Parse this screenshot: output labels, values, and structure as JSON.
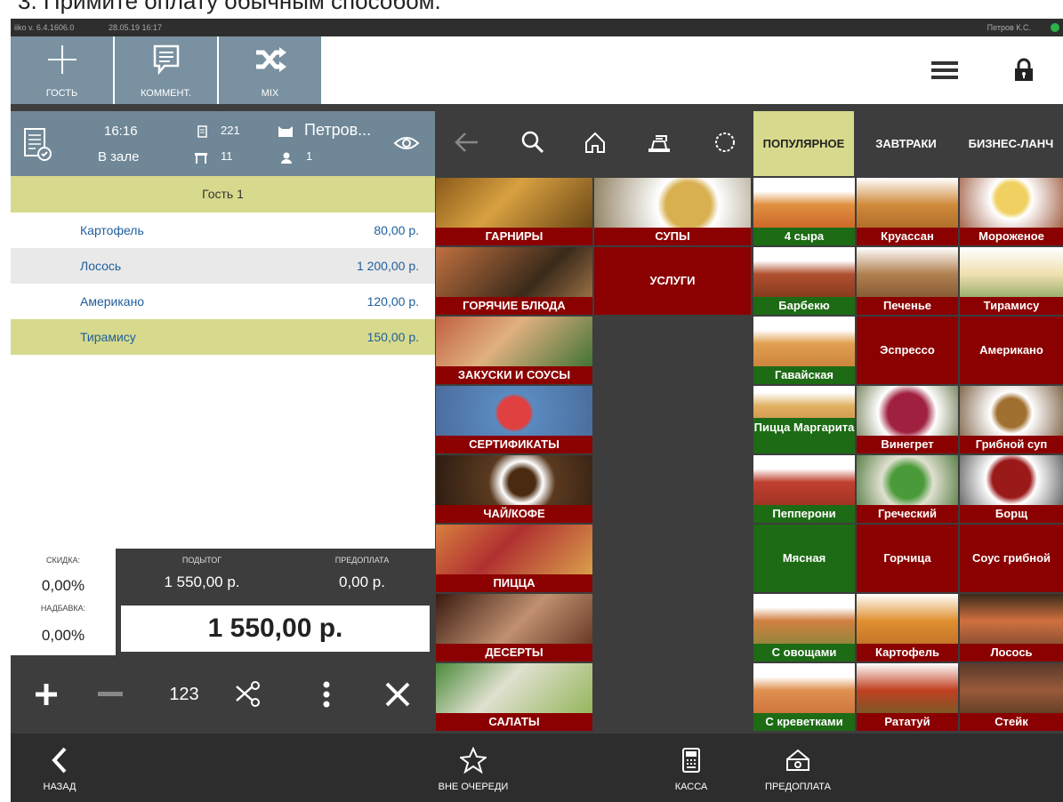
{
  "doc_text": "3.  Примите оплату обычным способом.",
  "status": {
    "version": "iiko v. 6.4.1606.0",
    "datetime": "28.05.19  16:17",
    "user": "Петров К.С."
  },
  "toolbar": {
    "guest": "ГОСТЬ",
    "comment": "КОММЕНТ.",
    "mix": "MIX"
  },
  "order_header": {
    "time": "16:16",
    "location": "В зале",
    "check_no": "221",
    "table_no": "11",
    "waiter": "Петров...",
    "guests": "1"
  },
  "order": {
    "guest_label": "Гость 1",
    "items": [
      {
        "name": "Картофель",
        "price": "80,00 р."
      },
      {
        "name": "Лосось",
        "price": "1 200,00 р."
      },
      {
        "name": "Американо",
        "price": "120,00 р."
      },
      {
        "name": "Тирамису",
        "price": "150,00 р."
      }
    ]
  },
  "totals": {
    "discount_label": "СКИДКА:",
    "discount_value": "0,00%",
    "surcharge_label": "НАДБАВКА:",
    "surcharge_value": "0,00%",
    "subtotal_label": "ПОДЫТОГ",
    "subtotal_value": "1 550,00 р.",
    "prepay_label": "ПРЕДОПЛАТА",
    "prepay_value": "0,00 р.",
    "total": "1 550,00 р."
  },
  "actions": {
    "numpad_label": "123"
  },
  "category_tabs": [
    "ПОПУЛЯРНОЕ",
    "ЗАВТРАКИ",
    "БИЗНЕС-ЛАНЧ"
  ],
  "categories": [
    "ГАРНИРЫ",
    "СУПЫ",
    "ГОРЯЧИЕ БЛЮДА",
    "УСЛУГИ",
    "ЗАКУСКИ И СОУСЫ",
    "СЕРТИФИКАТЫ",
    "ЧАЙ/КОФЕ",
    "ПИЦЦА",
    "ДЕСЕРТЫ",
    "САЛАТЫ"
  ],
  "products": [
    "4 сыра",
    "Круассан",
    "Мороженое",
    "Барбекю",
    "Печенье",
    "Тирамису",
    "Гавайская",
    "Эспрессо",
    "Американо",
    "Пицца Маргарита",
    "Винегрет",
    "Грибной суп",
    "Пепперони",
    "Греческий",
    "Борщ",
    "Мясная",
    "Горчица",
    "Соус грибной",
    "С овощами",
    "Картофель",
    "Лосось",
    "С креветками",
    "Рататуй",
    "Стейк"
  ],
  "bottom": {
    "back": "НАЗАД",
    "queue": "ВНЕ ОЧЕРЕДИ",
    "cash": "КАССА",
    "prepay": "ПРЕДОПЛАТА"
  },
  "colors": {
    "accent_yellow": "#d7da8c",
    "header_steel": "#7991a0",
    "dark_red": "#8b0000",
    "dark_green": "#1d6b15",
    "link_blue": "#1f5e9c"
  }
}
